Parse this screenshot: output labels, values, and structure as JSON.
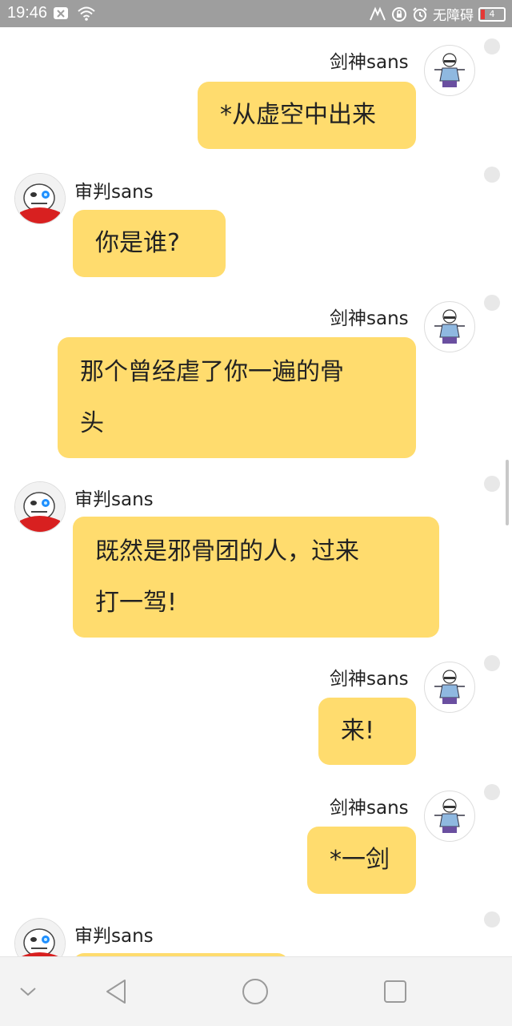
{
  "status_bar": {
    "time": "19:46",
    "accessibility_label": "无障碍",
    "battery_level": "4"
  },
  "messages": [
    {
      "sender": "剑神sans",
      "side": "right",
      "text": "*从虚空中出来"
    },
    {
      "sender": "审判sans",
      "side": "left",
      "text": "你是谁?"
    },
    {
      "sender": "剑神sans",
      "side": "right",
      "text_lines": [
        "那个曾经虐了你一遍的骨",
        "头"
      ]
    },
    {
      "sender": "审判sans",
      "side": "left",
      "text_lines": [
        "既然是邪骨团的人，过来",
        "打一驾!"
      ]
    },
    {
      "sender": "剑神sans",
      "side": "right",
      "text": "来!"
    },
    {
      "sender": "剑神sans",
      "side": "right",
      "text": "*一剑"
    },
    {
      "sender": "审判sans",
      "side": "left",
      "text": ""
    }
  ],
  "navbar": {
    "icons": [
      "chevron-down-icon",
      "back-icon",
      "home-icon",
      "recents-icon"
    ]
  }
}
